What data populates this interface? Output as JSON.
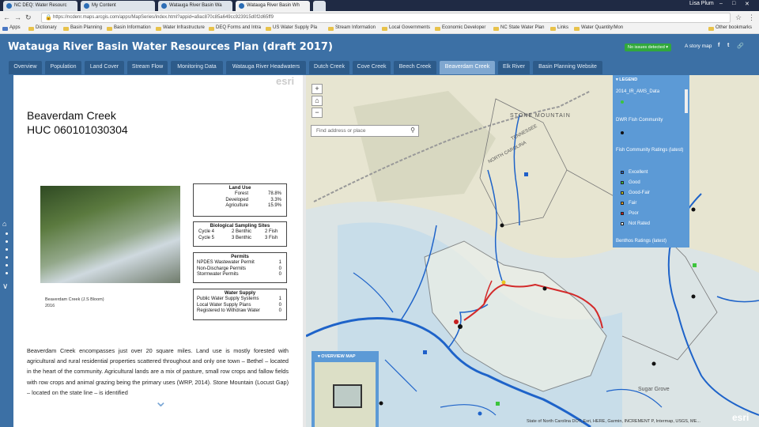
{
  "browser": {
    "tabs": [
      {
        "label": "NC DEQ: Water Resourc",
        "active": false
      },
      {
        "label": "My Content",
        "active": false
      },
      {
        "label": "Watauga River Basin Wa",
        "active": false
      },
      {
        "label": "Watauga River Basin Wh",
        "active": true
      }
    ],
    "window_user": "Lisa Plum",
    "url": "https://ncdenr.maps.arcgis.com/apps/MapSeries/index.html?appid=a9ac870c85a649cc923915d0f2d65ff9",
    "apps_label": "Apps",
    "bookmarks": [
      "Dictionary",
      "Basin Planning",
      "Basin Information",
      "Water Infrastructure",
      "DEQ Forms and Intra",
      "US Water Supply Pla",
      "Stream Information",
      "Local Governments",
      "Economic Developer",
      "NC State Water Plan",
      "Links",
      "Water Quantity/Mon"
    ],
    "other_bookmarks": "Other bookmarks"
  },
  "app": {
    "title": "Watauga River Basin Water Resources Plan (draft 2017)",
    "issues_badge": "No issues detected ▾",
    "story_map": "A story map",
    "social": [
      "f",
      "t",
      "🔗"
    ],
    "tabs": [
      "Overview",
      "Population",
      "Land Cover",
      "Stream Flow",
      "Monitoring Data",
      "Watauga River Headwaters",
      "Dutch Creek",
      "Cove Creek",
      "Beech Creek",
      "Beaverdam Creek",
      "Elk River",
      "Basin Planning Website"
    ],
    "active_tab": "Beaverdam Creek"
  },
  "panel": {
    "esri": "esri",
    "title_line1": "Beaverdam Creek",
    "title_line2": "HUC 060101030304",
    "caption_line1": "Beaverdam Creek (J.S Bloom)",
    "caption_line2": "2016",
    "land_use": {
      "header": "Land Use",
      "rows": [
        {
          "label": "Forest",
          "value": "78.8%"
        },
        {
          "label": "Developed",
          "value": "3.3%"
        },
        {
          "label": "Agriculture",
          "value": "15.9%"
        }
      ]
    },
    "sampling": {
      "header": "Biological Sampling Sites",
      "rows": [
        {
          "label": "Cycle 4",
          "a": "2 Benthic",
          "b": "2 Fish"
        },
        {
          "label": "Cycle 5",
          "a": "3 Benthic",
          "b": "3 Fish"
        }
      ]
    },
    "permits": {
      "header": "Permits",
      "rows": [
        {
          "label": "NPDES Wastewater Permit",
          "value": "1"
        },
        {
          "label": "Non-Discharge Permits",
          "value": "0"
        },
        {
          "label": "Stormwater Permits",
          "value": "0"
        }
      ]
    },
    "water_supply": {
      "header": "Water Supply",
      "rows": [
        {
          "label": "Public Water Supply Systems",
          "value": "1"
        },
        {
          "label": "Local Water Supply Plans",
          "value": "0"
        },
        {
          "label": "Registered to Withdraw Water",
          "value": "0"
        }
      ]
    },
    "body": "Beaverdam Creek encompasses just over 20 square miles. Land use is mostly forested with agricultural and rural residential properties scattered throughout and only one town – Bethel – located in the heart of the community. Agricultural lands are a mix of pasture, small row crops and fallow fields with row crops and animal grazing being the primary uses (WRP, 2014). Stone Mountain (Locust Gap) – located on the state line – is identified"
  },
  "map": {
    "search_placeholder": "Find address or place",
    "zoom_in": "+",
    "zoom_out": "−",
    "home": "⌂",
    "labels": [
      "STONE MOUNTAIN",
      "NORTH CAROLINA",
      "TENNESSEE",
      "Sugar Grove"
    ],
    "legend": {
      "title": "▾ LEGEND",
      "layer1": "2014_IR_AMS_Data",
      "layer2": "DWR Fish Community",
      "layer3": "Fish Community Ratings (latest)",
      "items": [
        {
          "label": "Excellent",
          "color": "#1f5fc9"
        },
        {
          "label": "Good",
          "color": "#3cc43c"
        },
        {
          "label": "Good-Fair",
          "color": "#c9c91f"
        },
        {
          "label": "Fair",
          "color": "#e8a020"
        },
        {
          "label": "Poor",
          "color": "#c71f1f"
        },
        {
          "label": "Not Rated",
          "color": "#ffffff"
        }
      ],
      "layer4": "Benthos Ratings (latest)"
    },
    "overview_title": "▾ OVERVIEW MAP",
    "attribution": "State of North Carolina DOT, Esri, HERE, Garmin, INCREMENT P, Intermap, USGS, ME...",
    "esri": "esri"
  }
}
